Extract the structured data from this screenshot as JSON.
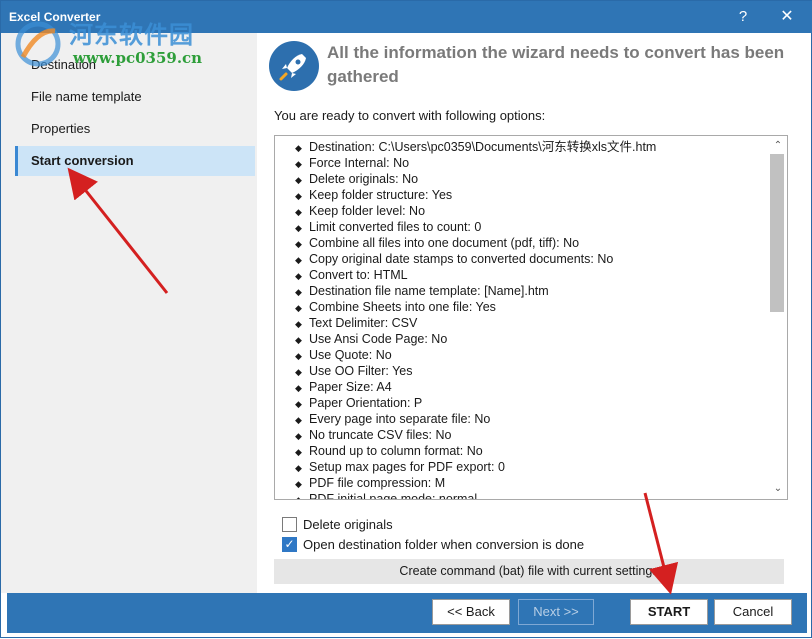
{
  "window": {
    "title": "Excel Converter",
    "help_glyph": "?",
    "close_glyph": "✕"
  },
  "watermark": {
    "text": "河东软件园",
    "url": "www.pc0359.cn"
  },
  "sidebar": {
    "items": [
      {
        "label": "Destination",
        "active": false
      },
      {
        "label": "File name template",
        "active": false
      },
      {
        "label": "Properties",
        "active": false
      },
      {
        "label": "Start conversion",
        "active": true
      }
    ]
  },
  "header": {
    "icon": "rocket-icon",
    "title": "All the information the wizard needs to convert has been gathered"
  },
  "ready_text": "You are ready to convert with following options:",
  "options": [
    "Destination: C:\\Users\\pc0359\\Documents\\河东转换xls文件.htm",
    "Force Internal: No",
    "Delete originals: No",
    "Keep folder structure: Yes",
    "Keep folder level: No",
    "Limit converted files to count: 0",
    "Combine all files into one document (pdf, tiff): No",
    "Copy original date stamps to converted documents: No",
    "Convert to: HTML",
    "Destination file name template: [Name].htm",
    "Combine Sheets into one file: Yes",
    "Text Delimiter: CSV",
    "Use Ansi Code Page: No",
    "Use Quote: No",
    "Use OO Filter: Yes",
    "Paper Size: A4",
    "Paper Orientation: P",
    "Every page into separate file: No",
    "No truncate CSV files: No",
    "Round up to column format: No",
    "Setup max pages for PDF export: 0",
    "PDF file compression: M",
    "PDF initial page mode: normal"
  ],
  "checkboxes": {
    "delete_originals": {
      "label": "Delete originals",
      "checked": false
    },
    "open_folder": {
      "label": "Open destination folder when conversion is done",
      "checked": true,
      "check_glyph": "✓"
    }
  },
  "bat_button_label": "Create command (bat) file with current settings",
  "footer": {
    "back_label": "<< Back",
    "next_label": "Next >>",
    "start_label": "START",
    "cancel_label": "Cancel"
  },
  "colors": {
    "accent": "#2f75b5",
    "annotation_arrow": "#d42020",
    "sidebar_active": "#cce4f7"
  },
  "glyphs": {
    "bullet": "◆",
    "scroll_up": "⌃",
    "scroll_down": "⌄"
  }
}
